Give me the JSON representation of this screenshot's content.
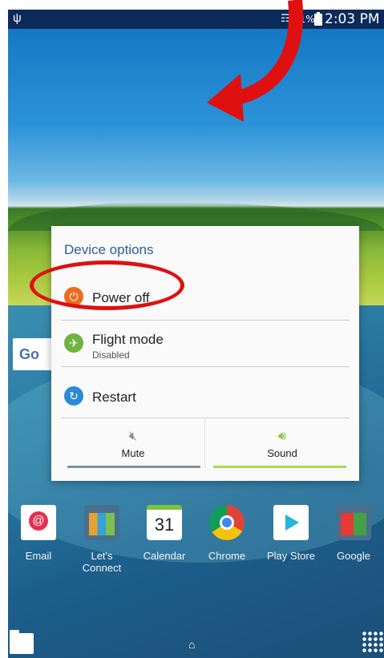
{
  "status_bar": {
    "usb_icon": "usb-icon",
    "wifi_icon": "wifi-icon",
    "battery_percent": "91%",
    "battery_icon": "battery-icon",
    "time": "2:03 PM"
  },
  "google_search": {
    "logo_text": "Go"
  },
  "device_options": {
    "title": "Device options",
    "options": [
      {
        "label": "Power off",
        "sublabel": "",
        "icon": "power-icon",
        "color": "#ee6a1e"
      },
      {
        "label": "Flight mode",
        "sublabel": "Disabled",
        "icon": "airplane-icon",
        "color": "#6fb342"
      },
      {
        "label": "Restart",
        "sublabel": "",
        "icon": "restart-icon",
        "color": "#2a8ad8"
      }
    ],
    "sound_modes": [
      {
        "label": "Mute",
        "icon": "mute-icon",
        "selected": false
      },
      {
        "label": "Sound",
        "icon": "sound-icon",
        "selected": true
      }
    ]
  },
  "dock_apps": [
    {
      "label": "Email",
      "icon": "email-icon"
    },
    {
      "label": "Let's Connect",
      "icon": "lets-connect-folder-icon"
    },
    {
      "label": "Calendar",
      "icon": "calendar-icon",
      "day": "31"
    },
    {
      "label": "Chrome",
      "icon": "chrome-icon"
    },
    {
      "label": "Play Store",
      "icon": "play-store-icon"
    },
    {
      "label": "Google",
      "icon": "google-folder-icon"
    }
  ],
  "bottom_bar": {
    "left_icon": "folder-icon",
    "center_icon": "home-icon",
    "right_icon": "apps-grid-icon"
  },
  "annotation": {
    "color": "#e01010"
  }
}
